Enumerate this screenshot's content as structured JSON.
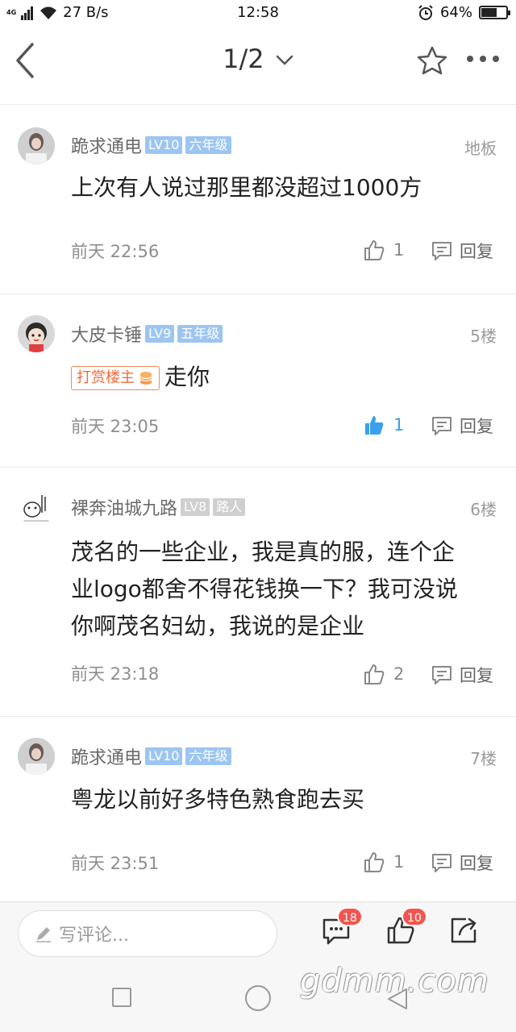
{
  "status": {
    "network_small": "4G",
    "speed": "27 B/s",
    "time": "12:58",
    "battery": "64%",
    "battery_level": 0.64
  },
  "nav": {
    "page": "1/2"
  },
  "posts": [
    {
      "username": "跪求通电",
      "level": "LV10",
      "grade": "六年级",
      "floor": "地板",
      "content": "上次有人说过那里都没超过1000方",
      "time": "前天 22:56",
      "likes": "1",
      "reply": "回复"
    },
    {
      "username": "大皮卡锤",
      "level": "LV9",
      "grade": "五年级",
      "floor": "5楼",
      "reward": "打赏楼主",
      "content": "走你",
      "time": "前天 23:05",
      "likes": "1",
      "reply": "回复"
    },
    {
      "username": "裸奔油城九路",
      "level": "LV8",
      "grade": "路人",
      "floor": "6楼",
      "content_lines": [
        "茂名的一些企业，我是真的服，连个企",
        "业logo都舍不得花钱换一下？我可没说",
        "你啊茂名妇幼，我说的是企业"
      ],
      "time": "前天 23:18",
      "likes": "2",
      "reply": "回复"
    },
    {
      "username": "跪求通电",
      "level": "LV10",
      "grade": "六年级",
      "floor": "7楼",
      "content": "粤龙以前好多特色熟食跑去买",
      "time": "前天 23:51",
      "likes": "1",
      "reply": "回复"
    }
  ],
  "bottom": {
    "placeholder": "写评论...",
    "comment_count": "18",
    "like_count": "10"
  },
  "watermark": "gdmm.com",
  "colors": {
    "accent": "#3aa0ee",
    "level_badge": "#9cc5f2",
    "reward": "#f06a3a",
    "badge": "#f2554f"
  }
}
